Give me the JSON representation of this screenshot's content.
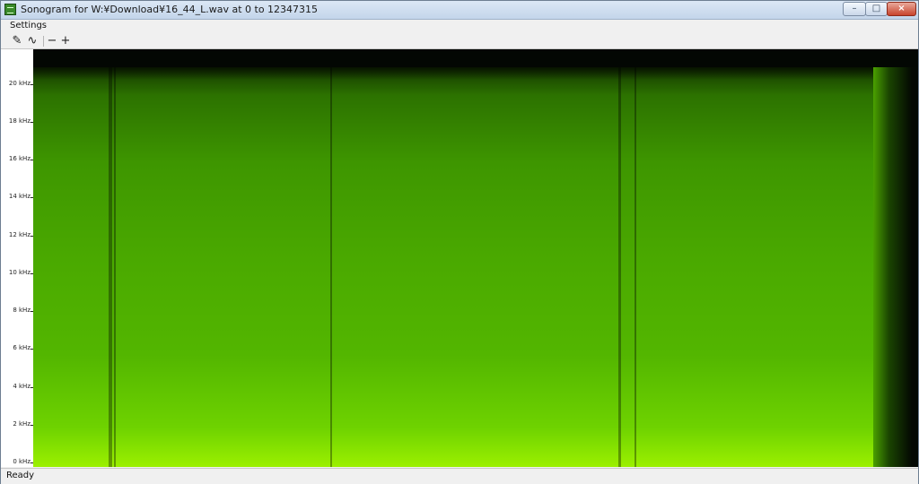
{
  "window": {
    "title": "Sonogram for W:¥Download¥16_44_L.wav at 0 to 12347315",
    "controls": {
      "minimize": "–",
      "maximize": "□",
      "close": "×"
    }
  },
  "menu": {
    "settings": "Settings"
  },
  "toolbar": {
    "wrench": "✎",
    "wave": "∿",
    "minus": "−",
    "plus": "+"
  },
  "axis": {
    "labels": [
      "20 kHz",
      "18 kHz",
      "16 kHz",
      "14 kHz",
      "12 kHz",
      "10 kHz",
      "8 kHz",
      "6 kHz",
      "4 kHz",
      "2 kHz",
      "0 kHz"
    ]
  },
  "status": {
    "text": "Ready"
  },
  "colors": {
    "spectrum_high": "#9bf000",
    "spectrum_mid": "#4aa900",
    "background_dark": "#030703"
  },
  "icons": [
    "wrench-icon",
    "wave-icon",
    "zoom-out-icon",
    "zoom-in-icon"
  ]
}
